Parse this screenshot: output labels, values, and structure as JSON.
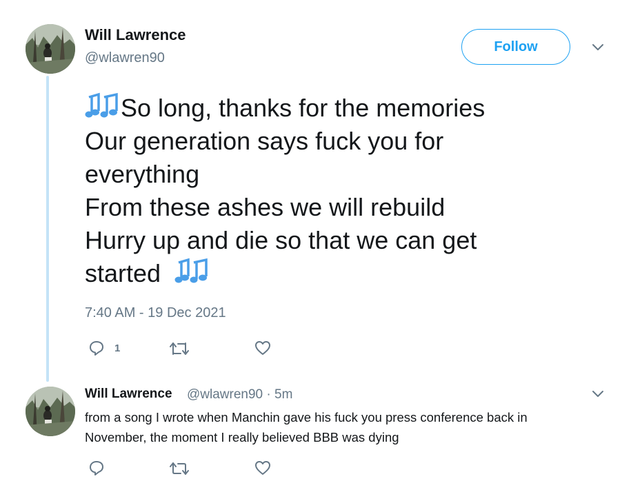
{
  "main_tweet": {
    "author_name": "Will Lawrence",
    "author_handle": "@wlawren90",
    "follow_label": "Follow",
    "lines": [
      "So long, thanks for the memories",
      "Our generation says fuck you for",
      "everything",
      "From these ashes we will rebuild",
      "Hurry up and die so that we can get",
      "started"
    ],
    "note_icon": "musical-notes-emoji",
    "timestamp": "7:40 AM - 19 Dec 2021",
    "reply_count": "1",
    "actions": [
      "reply-icon",
      "retweet-icon",
      "like-icon"
    ]
  },
  "reply_tweet": {
    "author_name": "Will Lawrence",
    "author_handle_time": "@wlawren90 · 5m",
    "lines": [
      "from a song I wrote when Manchin gave his fuck you press conference back in",
      "November, the moment I really believed BBB was dying"
    ],
    "actions": [
      "reply-icon",
      "retweet-icon",
      "like-icon"
    ]
  },
  "colors": {
    "accent": "#1da1f2",
    "thread_line": "#c4e3f7",
    "secondary_text": "#657786",
    "primary_text": "#14171a",
    "music_note": "#4a9ee8"
  }
}
